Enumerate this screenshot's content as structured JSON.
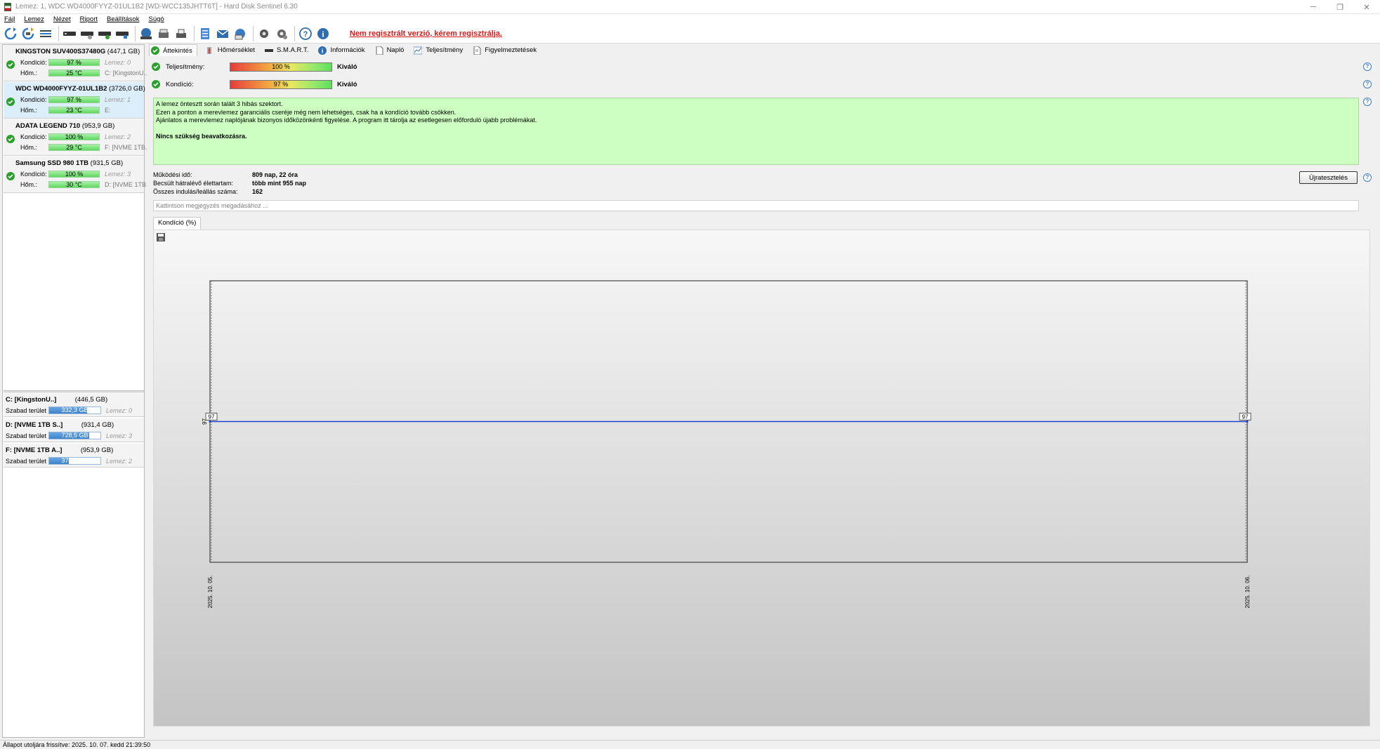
{
  "window": {
    "title": "Lemez: 1, WDC WD4000FYYZ-01UL1B2 [WD-WCC135JHTT6T]  -  Hard Disk Sentinel 6.30",
    "controls": [
      "─",
      "❐",
      "✕"
    ]
  },
  "menu": [
    "Fájl",
    "Lemez",
    "Nézet",
    "Riport",
    "Beállítások",
    "Súgó"
  ],
  "toolbar": {
    "register_link": "Nem regisztrált verzió, kérem regisztrálja."
  },
  "disks": [
    {
      "name": "KINGSTON SUV400S37480G",
      "size": "(447,1 GB)",
      "condition_label": "Kondíció:",
      "condition": "97 %",
      "condition_pct": 97,
      "temp_label": "Hőm.:",
      "temp": "25 °C",
      "disk_no": "Lemez: 0",
      "volume": "C: [KingstonU..."
    },
    {
      "name": "WDC WD4000FYYZ-01UL1B2",
      "size": "(3726,0 GB)",
      "condition_label": "Kondíció:",
      "condition": "97 %",
      "condition_pct": 97,
      "temp_label": "Hőm.:",
      "temp": "23 °C",
      "disk_no": "Lemez: 1",
      "volume": "E:"
    },
    {
      "name": "ADATA LEGEND 710",
      "size": "(953,9 GB)",
      "condition_label": "Kondíció:",
      "condition": "100 %",
      "condition_pct": 100,
      "temp_label": "Hőm.:",
      "temp": "29 °C",
      "disk_no": "Lemez: 2",
      "volume": "F: [NVME 1TB..."
    },
    {
      "name": "Samsung SSD 980 1TB",
      "size": "(931,5 GB)",
      "condition_label": "Kondíció:",
      "condition": "100 %",
      "condition_pct": 100,
      "temp_label": "Hőm.:",
      "temp": "30 °C",
      "disk_no": "Lemez: 3",
      "volume": "D: [NVME 1TB..."
    }
  ],
  "volumes": [
    {
      "name": "C: [KingstonU..]",
      "size": "(446,5 GB)",
      "free_label": "Szabad terület",
      "free": "332,3 GB",
      "free_pct": 74,
      "disk_no": "Lemez: 0"
    },
    {
      "name": "D: [NVME 1TB S..]",
      "size": "(931,4 GB)",
      "free_label": "Szabad terület",
      "free": "728,5 GB",
      "free_pct": 78,
      "disk_no": "Lemez: 3"
    },
    {
      "name": "F: [NVME 1TB A..]",
      "size": "(953,9 GB)",
      "free_label": "Szabad terület",
      "free": "376,3 GB",
      "free_pct": 39,
      "disk_no": "Lemez: 2"
    }
  ],
  "tabs": [
    "Áttekintés",
    "Hőmérséklet",
    "S.M.A.R.T.",
    "Információk",
    "Napló",
    "Teljesítmény",
    "Figyelmeztetések"
  ],
  "status": {
    "performance_label": "Teljesítmény:",
    "performance_value": "100 %",
    "performance_pct": 100,
    "performance_verdict": "Kiváló",
    "condition_label": "Kondíció:",
    "condition_value": "97 %",
    "condition_pct": 97,
    "condition_verdict": "Kiváló"
  },
  "info_text": {
    "line1": "A lemez öntesztt során talált 3 hibás szektort.",
    "line2": "Ezen a ponton a merevlemez garanciális cseréje még nem lehetséges, csak ha a kondíció tovább csökken.",
    "line3": "Ajánlatos a merevlemez naplójának bizonyos időközönkénti figyelése. A program itt tárolja az esetlegesen előforduló újabb problémákat.",
    "line4": "Nincs szükség beavatkozásra."
  },
  "stats": {
    "uptime_label": "Működési idő:",
    "uptime_value": "809 nap, 22 óra",
    "lifetime_label": "Becsült hátralévő élettartam:",
    "lifetime_value": "több mint 955 nap",
    "starts_label": "Összes indulás/leállás száma:",
    "starts_value": "162"
  },
  "retest_button": "Újratesztelés",
  "note_placeholder": "Kattintson megjegyzés megadásához ...",
  "chart_tab": "Kondíció  (%)",
  "chart_data": {
    "type": "line",
    "title": "",
    "xlabel": "",
    "ylabel": "",
    "x": [
      "2025. 10. 05.",
      "2025. 10. 06."
    ],
    "series": [
      {
        "values": [
          97,
          97
        ]
      }
    ],
    "y_tick_label": "97",
    "ylim": [
      96,
      98
    ],
    "grid": false,
    "line_color": "#1f3fd0"
  },
  "statusbar": "Állapot utoljára frissítve: 2025. 10. 07. kedd 21:39:50"
}
